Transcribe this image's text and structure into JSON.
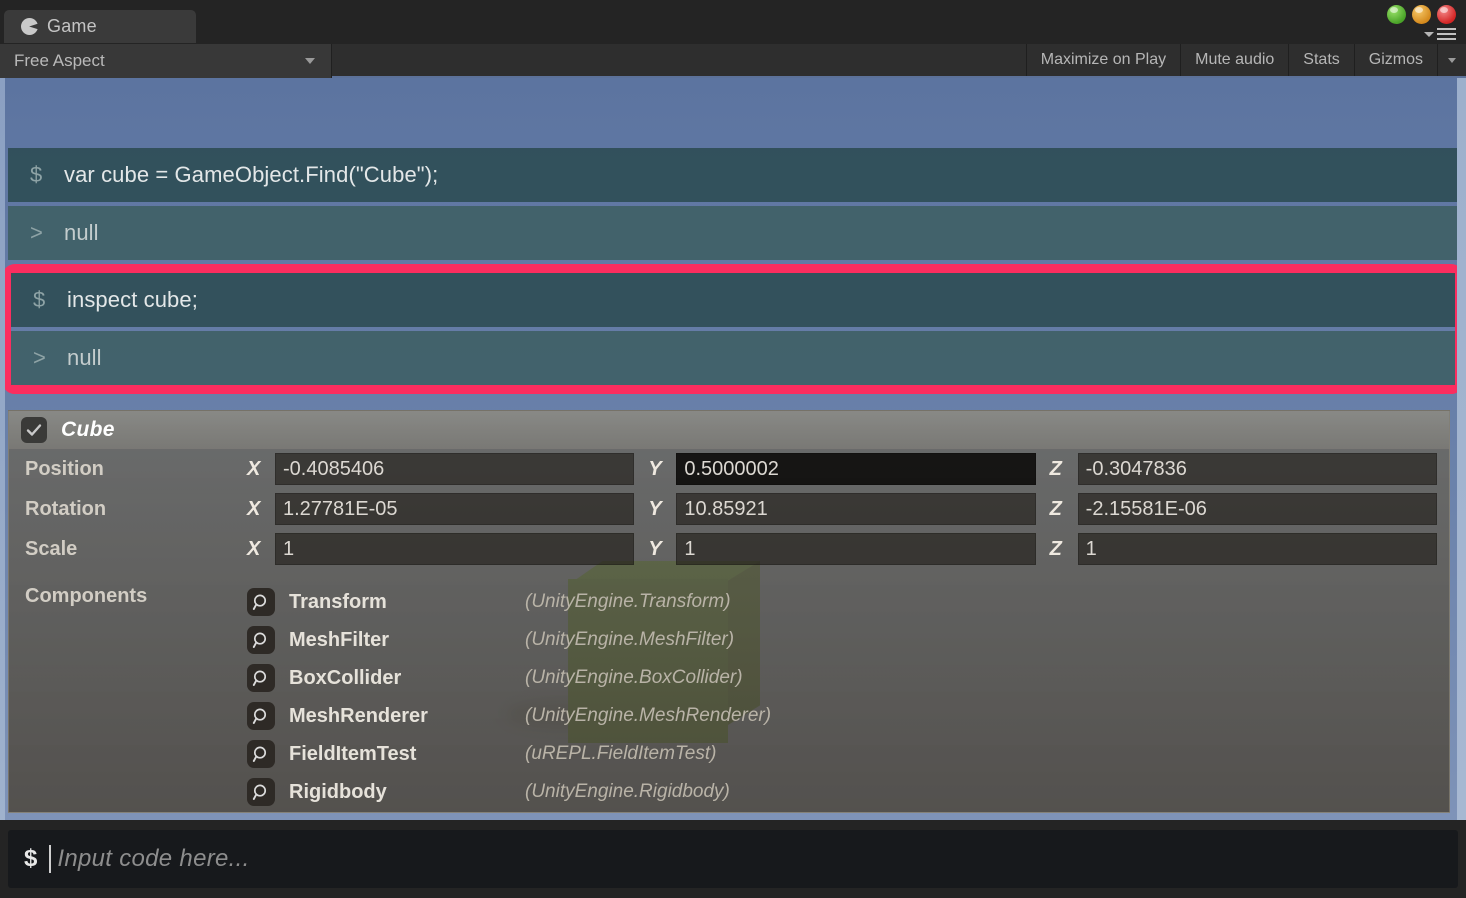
{
  "window": {
    "tab_label": "Game",
    "tab_icon": "unity-crescent-icon",
    "buttons": [
      {
        "name": "minimize",
        "color": "#6fc93a"
      },
      {
        "name": "maximize",
        "color": "#e0a028"
      },
      {
        "name": "close",
        "color": "#e03434"
      }
    ]
  },
  "toolbar": {
    "aspect_label": "Free Aspect",
    "maximize_on_play": "Maximize on Play",
    "mute_audio": "Mute audio",
    "stats": "Stats",
    "gizmos": "Gizmos"
  },
  "repl": {
    "entries": [
      {
        "highlighted": false,
        "input_prompt": "$",
        "input_text": "var cube = GameObject.Find(\"Cube\");",
        "output_prompt": ">",
        "output_text": "null"
      },
      {
        "highlighted": true,
        "input_prompt": "$",
        "input_text": "inspect cube;",
        "output_prompt": ">",
        "output_text": "null"
      }
    ],
    "highlight_color": "#fb2d5f"
  },
  "inspector": {
    "title": "Cube",
    "enabled": true,
    "transform": [
      {
        "label": "Position",
        "x_letter": "X",
        "x_value": "-0.4085406",
        "y_letter": "Y",
        "y_value": "0.5000002",
        "z_letter": "Z",
        "z_value": "-0.3047836"
      },
      {
        "label": "Rotation",
        "x_letter": "X",
        "x_value": "1.27781E-05",
        "y_letter": "Y",
        "y_value": "10.85921",
        "z_letter": "Z",
        "z_value": "-2.15581E-06"
      },
      {
        "label": "Scale",
        "x_letter": "X",
        "x_value": "1",
        "y_letter": "Y",
        "y_value": "1",
        "z_letter": "Z",
        "z_value": "1"
      }
    ],
    "components_label": "Components",
    "components": [
      {
        "name": "Transform",
        "type": "(UnityEngine.Transform)"
      },
      {
        "name": "MeshFilter",
        "type": "(UnityEngine.MeshFilter)"
      },
      {
        "name": "BoxCollider",
        "type": "(UnityEngine.BoxCollider)"
      },
      {
        "name": "MeshRenderer",
        "type": "(UnityEngine.MeshRenderer)"
      },
      {
        "name": "FieldItemTest",
        "type": "(uREPL.FieldItemTest)"
      },
      {
        "name": "Rigidbody",
        "type": "(UnityEngine.Rigidbody)"
      }
    ]
  },
  "code_input": {
    "prompt": "$",
    "placeholder": "Input code here..."
  },
  "scene": {
    "cube_color": "#3f7a17",
    "sky_top": "#5c74a0",
    "sky_bottom": "#7e93b8"
  }
}
